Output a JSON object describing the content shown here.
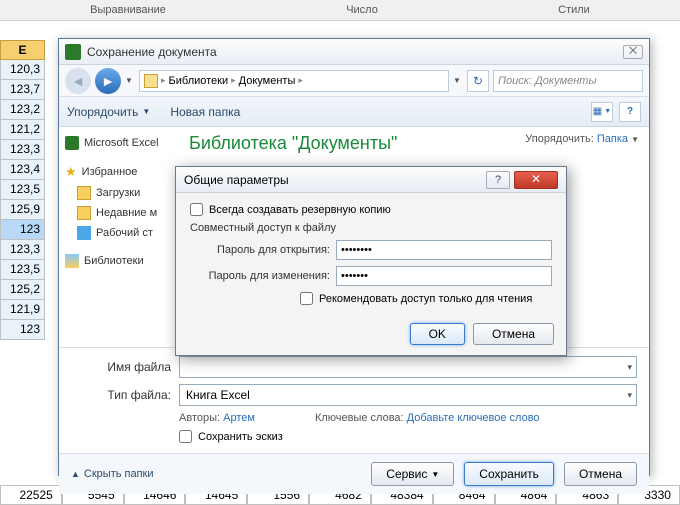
{
  "ribbon": {
    "align": "Выравнивание",
    "number": "Число",
    "styles": "Стили"
  },
  "col_header": "E",
  "col_cells": [
    "120,3",
    "123,7",
    "123,2",
    "121,2",
    "123,3",
    "123,4",
    "123,5",
    "125,9",
    "123",
    "123,3",
    "123,5",
    "125,2",
    "121,9",
    "123"
  ],
  "bottom_cells": [
    "22525",
    "5545",
    "14646",
    "14645",
    "1556",
    "4682",
    "48384",
    "8464",
    "4864",
    "4863",
    "3330"
  ],
  "save": {
    "title": "Сохранение документа",
    "breadcrumb": {
      "root": "Библиотеки",
      "folder": "Документы"
    },
    "search_placeholder": "Поиск: Документы",
    "toolbar": {
      "organize": "Упорядочить",
      "new_folder": "Новая папка"
    },
    "sidebar": {
      "excel": "Microsoft Excel",
      "fav": "Избранное",
      "downloads": "Загрузки",
      "recent": "Недавние м",
      "desktop": "Рабочий ст",
      "libraries": "Библиотеки"
    },
    "content": {
      "title": "Библиотека \"Документы\"",
      "arrange_label": "Упорядочить:",
      "arrange_value": "Папка"
    },
    "filename_label": "Имя файла",
    "filetype_label": "Тип файла:",
    "filetype_value": "Книга Excel",
    "authors_label": "Авторы:",
    "authors_value": "Артем",
    "keywords_label": "Ключевые слова:",
    "keywords_value": "Добавьте ключевое слово",
    "save_thumb": "Сохранить эскиз",
    "hide_folders": "Скрыть папки",
    "tools": "Сервис",
    "save_btn": "Сохранить",
    "cancel_btn": "Отмена"
  },
  "gen": {
    "title": "Общие параметры",
    "backup": "Всегда создавать резервную копию",
    "share": "Совместный доступ к файлу",
    "pw_open": "Пароль для открытия:",
    "pw_mod": "Пароль для изменения:",
    "pw_open_val": "••••••••",
    "pw_mod_val": "•••••••",
    "readonly": "Рекомендовать доступ только для чтения",
    "ok": "OK",
    "cancel": "Отмена"
  }
}
